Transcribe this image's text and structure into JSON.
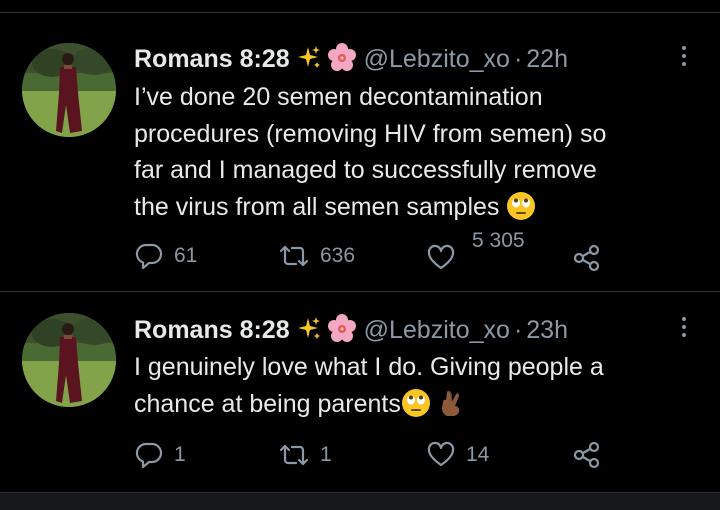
{
  "colors": {
    "background": "#000000",
    "text": "#e7e9ea",
    "secondary": "#8b98a5",
    "divider": "#2f3336"
  },
  "tweets": [
    {
      "display_name": "Romans 8:28",
      "name_emojis": [
        "sparkles-icon",
        "cherry-blossom-icon"
      ],
      "handle": "@Lebzito_xo",
      "separator": "·",
      "time": "22h",
      "lines": [
        "I’ve done 20 semen decontamination",
        "procedures (removing HIV from semen) so",
        "far and I managed to successfully remove",
        "the virus from all semen samples"
      ],
      "trailing_emoji": "face-with-rolling-eyes-icon",
      "replies": "61",
      "retweets": "636",
      "likes": "5 305"
    },
    {
      "display_name": "Romans 8:28",
      "name_emojis": [
        "sparkles-icon",
        "cherry-blossom-icon"
      ],
      "handle": "@Lebzito_xo",
      "separator": "·",
      "time": "23h",
      "lines": [
        "I genuinely love what I do. Giving people a",
        "chance at being parents"
      ],
      "trailing_emoji": "face-with-rolling-eyes-icon, crossed-fingers-icon",
      "replies": "1",
      "retweets": "1",
      "likes": "14"
    }
  ]
}
